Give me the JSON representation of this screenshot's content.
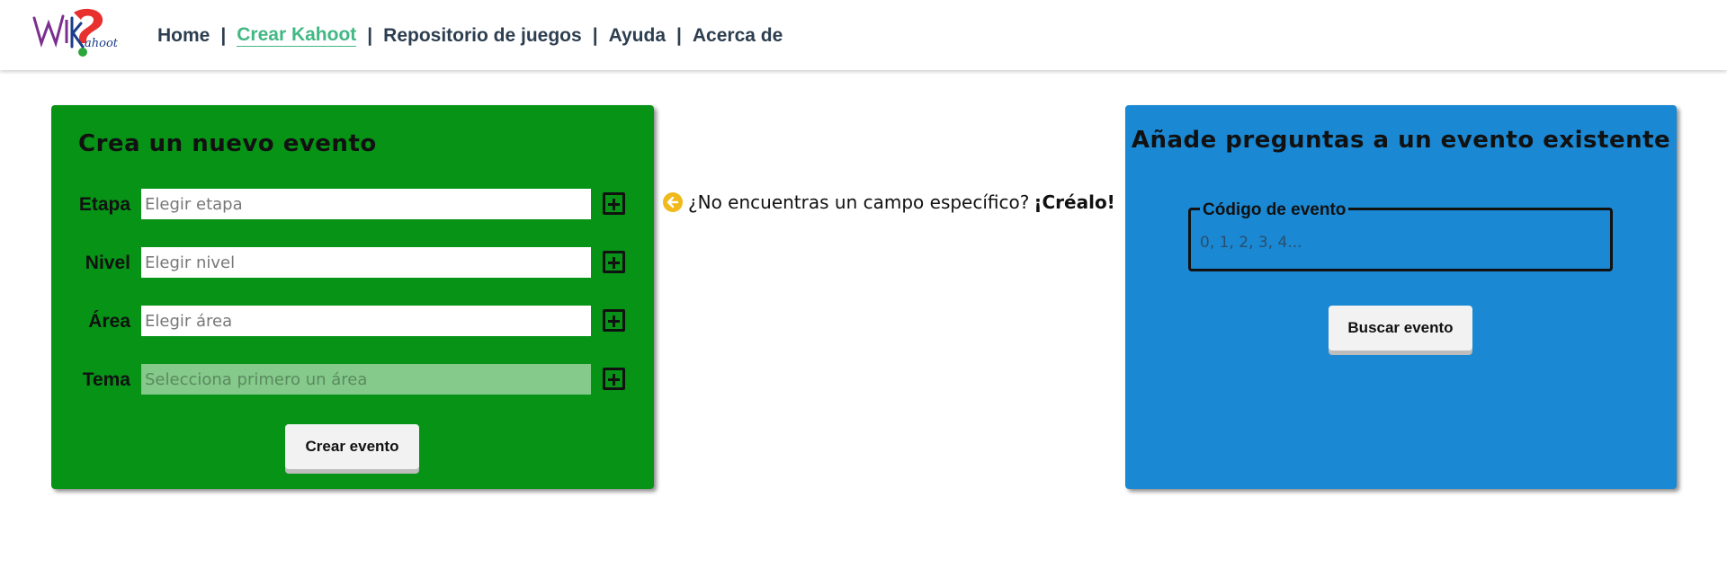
{
  "nav": {
    "logo_text": "WiKahoot",
    "items": [
      {
        "label": "Home"
      },
      {
        "label": "Crear Kahoot"
      },
      {
        "label": "Repositorio de juegos"
      },
      {
        "label": "Ayuda"
      },
      {
        "label": "Acerca de"
      }
    ],
    "separator": "|",
    "active_index": 1
  },
  "create_panel": {
    "title": "Crea un nuevo evento",
    "rows": [
      {
        "label": "Etapa",
        "placeholder": "Elegir etapa",
        "value": ""
      },
      {
        "label": "Nivel",
        "placeholder": "Elegir nivel",
        "value": ""
      },
      {
        "label": "Área",
        "placeholder": "Elegir área",
        "value": ""
      },
      {
        "label": "Tema",
        "placeholder": "Selecciona primero un área",
        "value": "",
        "disabled": true
      }
    ],
    "add_icon": "plus-square-icon",
    "button_label": "Crear evento",
    "bg_color": "#069316"
  },
  "hint": {
    "icon": "arrow-left-circle-icon",
    "text": "¿No encuentras un campo específico?",
    "cta": "¡Créalo!"
  },
  "existing_panel": {
    "title": "Añade preguntas a un evento existente",
    "field_legend": "Código de evento",
    "field_placeholder": "0, 1, 2, 3, 4...",
    "button_label": "Buscar evento",
    "bg_color": "#1a88d3"
  },
  "colors": {
    "nav_text": "#2c3e50",
    "nav_active": "#41b883",
    "hint_icon": "#f0b91c"
  }
}
